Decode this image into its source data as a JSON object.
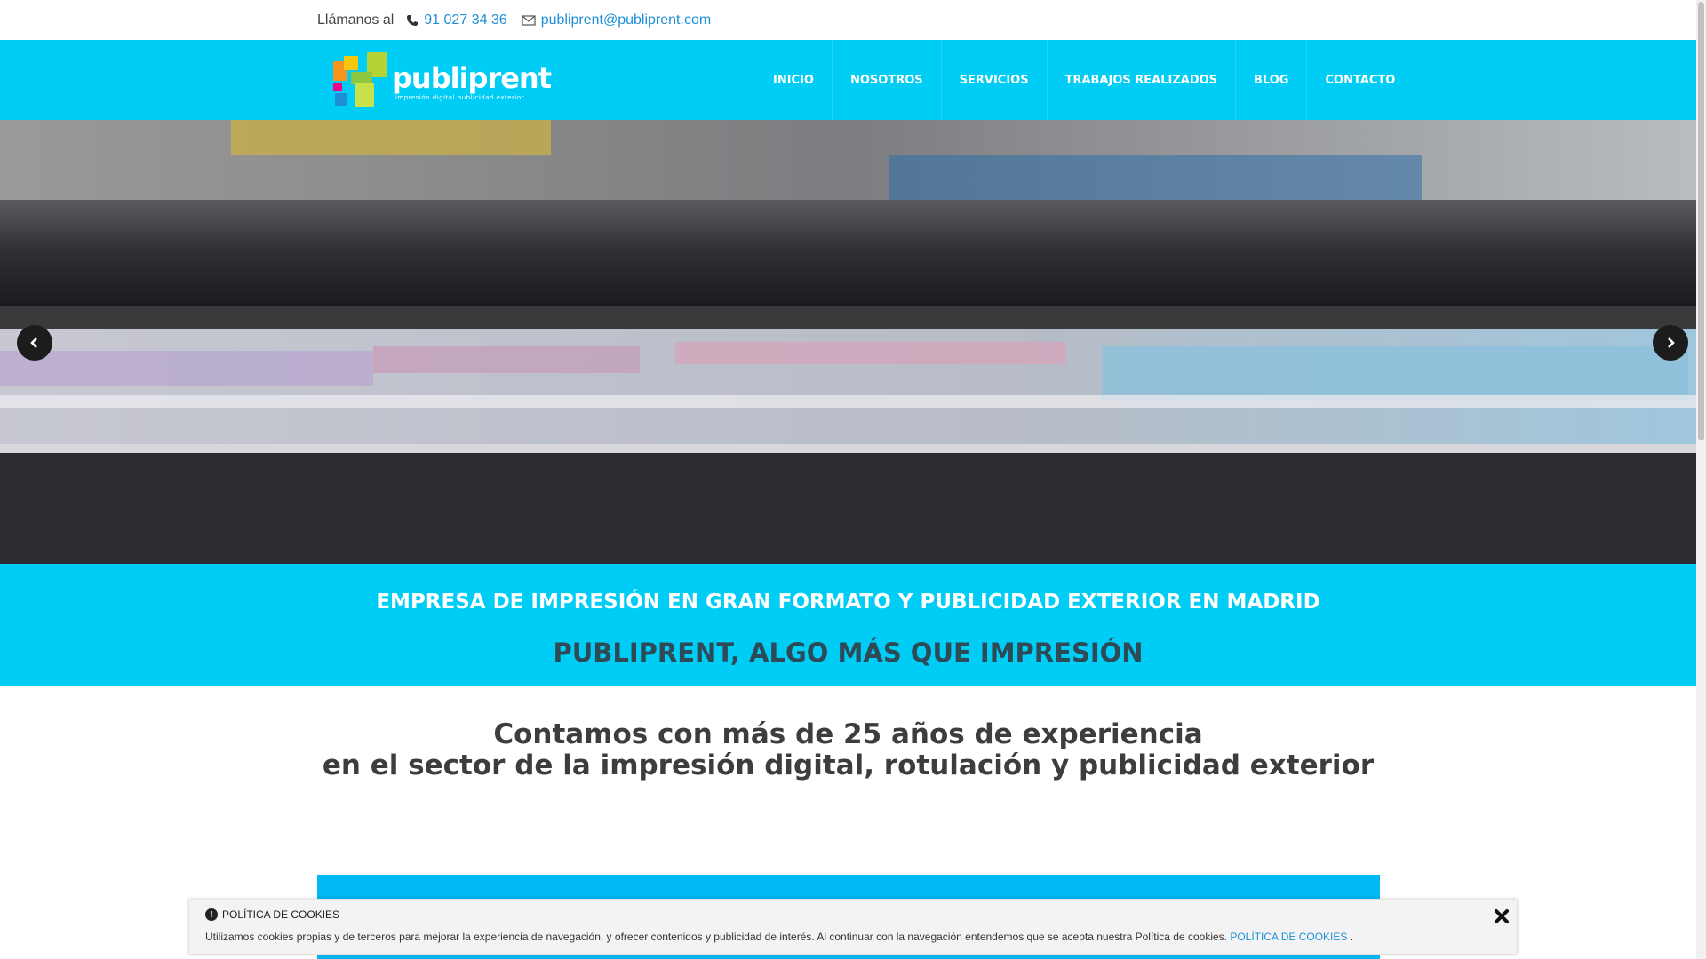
{
  "topbar": {
    "call_label": "Llámanos al",
    "phone": "91 027 34 36",
    "email": "publiprent@publiprent.com",
    "phone_icon": "phone-icon",
    "email_icon": "envelope-icon"
  },
  "logo": {
    "name": "publiprent",
    "tagline": "impresión digital   publicidad exterior"
  },
  "nav": {
    "items": [
      {
        "label": "INICIO"
      },
      {
        "label": "NOSOTROS"
      },
      {
        "label": "SERVICIOS"
      },
      {
        "label": "TRABAJOS REALIZADOS"
      },
      {
        "label": "BLOG"
      },
      {
        "label": "CONTACTO"
      }
    ]
  },
  "slider": {
    "prev_icon": "chevron-left-icon",
    "next_icon": "chevron-right-icon"
  },
  "banner": {
    "line1": "EMPRESA DE IMPRESIÓN EN GRAN FORMATO Y PUBLICIDAD EXTERIOR EN MADRID",
    "line2": "PUBLIPRENT, ALGO MÁS QUE IMPRESIÓN"
  },
  "experience": {
    "line1": "Contamos con más de 25 años de experiencia",
    "line2": "en el sector de la impresión digital, rotulación y publicidad exterior"
  },
  "cookie": {
    "title": "POLÍTICA DE COOKIES",
    "text": "Utilizamos cookies propias y de terceros para mejorar la experiencia de navegación, y ofrecer contenidos y publicidad de interés. Al continuar con la navegación entendemos que se acepta nuestra Política de cookies.",
    "link": "POLÍTICA DE COOKIES",
    "link_suffix": ".",
    "info_icon": "info-icon",
    "close_icon": "close-icon"
  },
  "colors": {
    "brand_cyan": "#00cdf5",
    "link_blue": "#1e8fd6",
    "dark_teal": "#2f4a57"
  }
}
